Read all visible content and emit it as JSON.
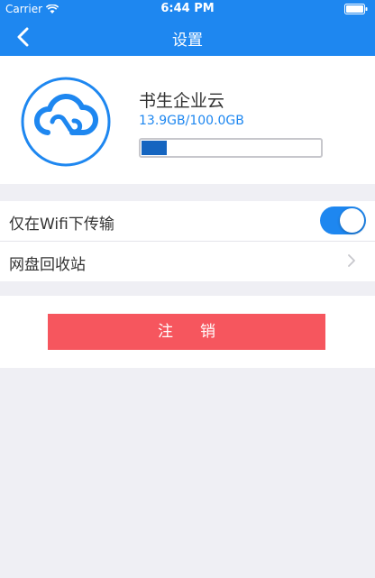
{
  "status_bar": {
    "carrier": "Carrier",
    "time": "6:44 PM"
  },
  "nav": {
    "title": "设置"
  },
  "profile": {
    "app_name": "书生企业云",
    "storage_text": "13.9GB/100.0GB",
    "storage_used_fraction": 0.139
  },
  "settings": {
    "wifi_only_label": "仅在Wifi下传输",
    "wifi_only_enabled": true,
    "recycle_bin_label": "网盘回收站"
  },
  "logout": {
    "label": "注销"
  },
  "colors": {
    "accent": "#1e87f0",
    "progress_fill": "#1565c0",
    "logout": "#f6565e",
    "background": "#efeff4"
  }
}
